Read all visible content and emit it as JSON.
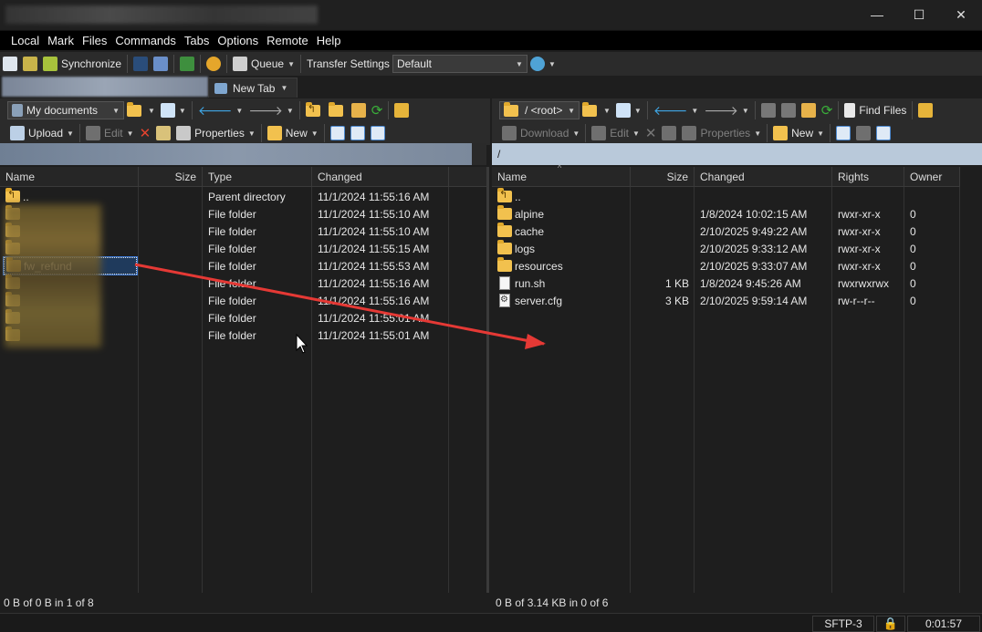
{
  "window": {
    "minimize": "—",
    "maximize": "☐",
    "close": "✕"
  },
  "menu": [
    "Local",
    "Mark",
    "Files",
    "Commands",
    "Tabs",
    "Options",
    "Remote",
    "Help"
  ],
  "main_toolbar": {
    "synchronize": "Synchronize",
    "queue": "Queue",
    "transfer_settings": "Transfer Settings",
    "transfer_value": "Default"
  },
  "tabs": {
    "new_tab": "New Tab"
  },
  "left": {
    "location": "My documents",
    "upload": "Upload",
    "edit": "Edit",
    "properties": "Properties",
    "new": "New",
    "columns": [
      "Name",
      "Size",
      "Type",
      "Changed"
    ],
    "rows": [
      {
        "name": "..",
        "size": "",
        "type": "Parent directory",
        "changed": "11/1/2024 11:55:16 AM"
      },
      {
        "name": "",
        "size": "",
        "type": "File folder",
        "changed": "11/1/2024 11:55:10 AM"
      },
      {
        "name": "",
        "size": "",
        "type": "File folder",
        "changed": "11/1/2024 11:55:10 AM"
      },
      {
        "name": "",
        "size": "",
        "type": "File folder",
        "changed": "11/1/2024 11:55:15 AM"
      },
      {
        "name": "fw_refund",
        "size": "",
        "type": "File folder",
        "changed": "11/1/2024 11:55:53 AM"
      },
      {
        "name": "",
        "size": "",
        "type": "File folder",
        "changed": "11/1/2024 11:55:16 AM"
      },
      {
        "name": "",
        "size": "",
        "type": "File folder",
        "changed": "11/1/2024 11:55:16 AM"
      },
      {
        "name": "",
        "size": "",
        "type": "File folder",
        "changed": "11/1/2024 11:55:01 AM"
      },
      {
        "name": "",
        "size": "",
        "type": "File folder",
        "changed": "11/1/2024 11:55:01 AM"
      }
    ],
    "status": "0 B of 0 B in 1 of 8"
  },
  "right": {
    "location": "/ <root>",
    "path": "/",
    "download": "Download",
    "edit": "Edit",
    "properties": "Properties",
    "new": "New",
    "find_files": "Find Files",
    "columns": [
      "Name",
      "Size",
      "Changed",
      "Rights",
      "Owner"
    ],
    "rows": [
      {
        "name": "..",
        "size": "",
        "changed": "",
        "rights": "",
        "owner": "",
        "kind": "up"
      },
      {
        "name": "alpine",
        "size": "",
        "changed": "1/8/2024 10:02:15 AM",
        "rights": "rwxr-xr-x",
        "owner": "0",
        "kind": "folder"
      },
      {
        "name": "cache",
        "size": "",
        "changed": "2/10/2025 9:49:22 AM",
        "rights": "rwxr-xr-x",
        "owner": "0",
        "kind": "folder"
      },
      {
        "name": "logs",
        "size": "",
        "changed": "2/10/2025 9:33:12 AM",
        "rights": "rwxr-xr-x",
        "owner": "0",
        "kind": "folder"
      },
      {
        "name": "resources",
        "size": "",
        "changed": "2/10/2025 9:33:07 AM",
        "rights": "rwxr-xr-x",
        "owner": "0",
        "kind": "folder"
      },
      {
        "name": "run.sh",
        "size": "1 KB",
        "changed": "1/8/2024 9:45:26 AM",
        "rights": "rwxrwxrwx",
        "owner": "0",
        "kind": "file"
      },
      {
        "name": "server.cfg",
        "size": "3 KB",
        "changed": "2/10/2025 9:59:14 AM",
        "rights": "rw-r--r--",
        "owner": "0",
        "kind": "cfg"
      }
    ],
    "status": "0 B of 3.14 KB in 0 of 6"
  },
  "bottom": {
    "protocol": "SFTP-3",
    "timer": "0:01:57"
  },
  "colors": {
    "arrow": "#e53935",
    "path_bg": "#b9c9da",
    "selection_border": "#3d7bd9"
  }
}
